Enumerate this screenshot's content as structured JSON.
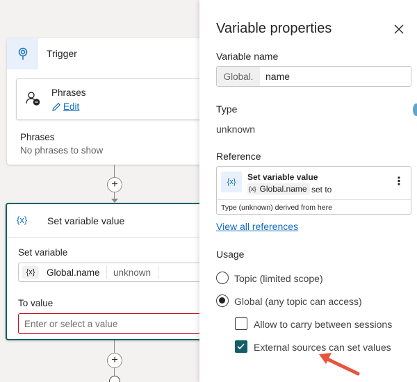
{
  "canvas": {
    "trigger": {
      "title": "Trigger",
      "phrases_card_title": "Phrases",
      "edit_link": "Edit",
      "phrases_label": "Phrases",
      "phrases_empty": "No phrases to show"
    },
    "set_variable_node": {
      "icon": "{x}",
      "title": "Set variable value",
      "set_variable_label": "Set variable",
      "variable_icon": "{x}",
      "variable_name": "Global.name",
      "variable_type": "unknown",
      "to_value_label": "To value",
      "to_value_placeholder": "Enter or select a value"
    },
    "add_step_symbol": "+"
  },
  "panel": {
    "title": "Variable properties",
    "variable_name_label": "Variable name",
    "name_prefix": "Global.",
    "name_value": "name",
    "type_label": "Type",
    "type_value": "unknown",
    "reference_label": "Reference",
    "reference": {
      "icon": "{x}",
      "title": "Set variable value",
      "chip_icon": "{x}",
      "chip_text": "Global.name",
      "suffix": "set to",
      "more": "⋮",
      "footer": "Type (unknown) derived from here"
    },
    "view_all_link": "View all references",
    "usage_label": "Usage",
    "usage_options": [
      {
        "label": "Topic (limited scope)",
        "checked": false
      },
      {
        "label": "Global (any topic can access)",
        "checked": true
      }
    ],
    "checkboxes": [
      {
        "label": "Allow to carry between sessions",
        "checked": false
      },
      {
        "label": "External sources can set values",
        "checked": true
      }
    ]
  },
  "colors": {
    "accent_teal": "#115e67",
    "link_blue": "#0f6cbd",
    "error_red": "#c50f1f",
    "annotation_arrow": "#e8543f"
  }
}
